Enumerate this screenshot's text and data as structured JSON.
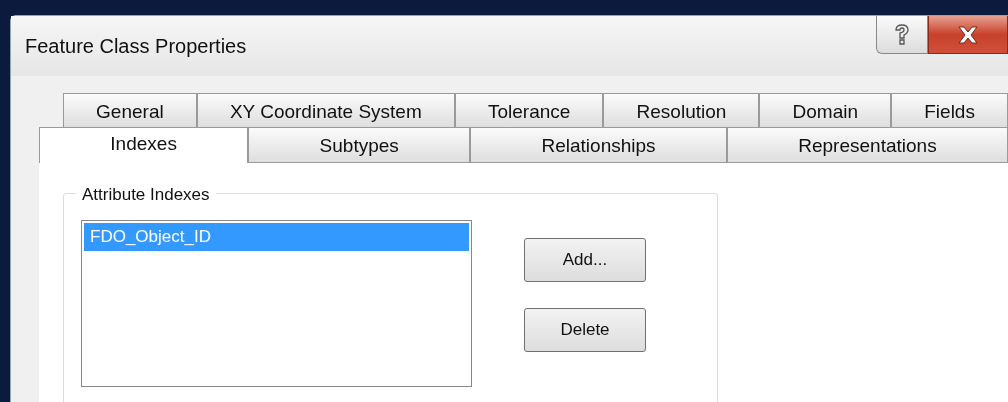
{
  "window": {
    "title": "Feature Class Properties"
  },
  "tab_rows": [
    {
      "tabs": [
        {
          "label": "General",
          "selected": false
        },
        {
          "label": "XY Coordinate System",
          "selected": false
        },
        {
          "label": "Tolerance",
          "selected": false
        },
        {
          "label": "Resolution",
          "selected": false
        },
        {
          "label": "Domain",
          "selected": false
        },
        {
          "label": "Fields",
          "selected": false
        }
      ]
    },
    {
      "tabs": [
        {
          "label": "Indexes",
          "selected": true
        },
        {
          "label": "Subtypes",
          "selected": false
        },
        {
          "label": "Relationships",
          "selected": false
        },
        {
          "label": "Representations",
          "selected": false
        }
      ]
    }
  ],
  "attribute_indexes": {
    "title": "Attribute Indexes",
    "items": [
      {
        "label": "FDO_Object_ID",
        "selected": true
      }
    ],
    "buttons": [
      "Add...",
      "Delete"
    ]
  }
}
